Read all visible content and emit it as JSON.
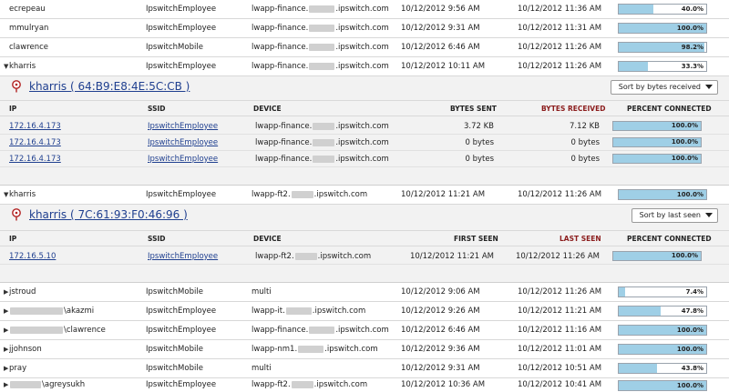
{
  "rows_top": [
    {
      "user": "ecrepeau",
      "ssid": "IpswitchEmployee",
      "dev_a": "lwapp-finance.",
      "dev_b": ".ipswitch.com",
      "first": "10/12/2012 9:56 AM",
      "last": "10/12/2012 11:36 AM",
      "pct": "40.0%",
      "pct_val": 40.0,
      "arrow": ""
    },
    {
      "user": "mmulryan",
      "ssid": "IpswitchEmployee",
      "dev_a": "lwapp-finance.",
      "dev_b": ".ipswitch.com",
      "first": "10/12/2012 9:31 AM",
      "last": "10/12/2012 11:31 AM",
      "pct": "100.0%",
      "pct_val": 100.0,
      "arrow": ""
    },
    {
      "user": "clawrence",
      "ssid": "IpswitchMobile",
      "dev_a": "lwapp-finance.",
      "dev_b": ".ipswitch.com",
      "first": "10/12/2012 6:46 AM",
      "last": "10/12/2012 11:26 AM",
      "pct": "98.2%",
      "pct_val": 98.2,
      "arrow": ""
    },
    {
      "user": "kharris",
      "ssid": "IpswitchEmployee",
      "dev_a": "lwapp-finance.",
      "dev_b": ".ipswitch.com",
      "first": "10/12/2012 10:11 AM",
      "last": "10/12/2012 11:26 AM",
      "pct": "33.3%",
      "pct_val": 33.3,
      "arrow": "▼"
    }
  ],
  "panel1": {
    "title": "kharris ( 64:B9:E8:4E:5C:CB )",
    "sort_label": "Sort by bytes received",
    "headers": {
      "ip": "IP",
      "ssid": "SSID",
      "device": "DEVICE",
      "col4": "BYTES SENT",
      "col5": "BYTES RECEIVED",
      "pct": "PERCENT CONNECTED"
    },
    "rows": [
      {
        "ip": "172.16.4.173",
        "ssid": "IpswitchEmployee",
        "dev_a": "lwapp-finance.",
        "dev_b": ".ipswitch.com",
        "c4": "3.72 KB",
        "c5": "7.12 KB",
        "pct": "100.0%",
        "pct_val": 100.0
      },
      {
        "ip": "172.16.4.173",
        "ssid": "IpswitchEmployee",
        "dev_a": "lwapp-finance.",
        "dev_b": ".ipswitch.com",
        "c4": "0 bytes",
        "c5": "0 bytes",
        "pct": "100.0%",
        "pct_val": 100.0
      },
      {
        "ip": "172.16.4.173",
        "ssid": "IpswitchEmployee",
        "dev_a": "lwapp-finance.",
        "dev_b": ".ipswitch.com",
        "c4": "0 bytes",
        "c5": "0 bytes",
        "pct": "100.0%",
        "pct_val": 100.0
      }
    ]
  },
  "row_mid": {
    "user": "kharris",
    "ssid": "IpswitchEmployee",
    "dev_a": "lwapp-ft2.",
    "dev_b": ".ipswitch.com",
    "first": "10/12/2012 11:21 AM",
    "last": "10/12/2012 11:26 AM",
    "pct": "100.0%",
    "pct_val": 100.0,
    "arrow": "▼"
  },
  "panel2": {
    "title": "kharris ( 7C:61:93:F0:46:96 )",
    "sort_label": "Sort by last seen",
    "headers": {
      "ip": "IP",
      "ssid": "SSID",
      "device": "DEVICE",
      "col4": "FIRST SEEN",
      "col5": "LAST SEEN",
      "pct": "PERCENT CONNECTED"
    },
    "rows": [
      {
        "ip": "172.16.5.10",
        "ssid": "IpswitchEmployee",
        "dev_a": "lwapp-ft2.",
        "dev_b": ".ipswitch.com",
        "c4": "10/12/2012 11:21 AM",
        "c5": "10/12/2012 11:26 AM",
        "pct": "100.0%",
        "pct_val": 100.0
      }
    ]
  },
  "rows_bottom": [
    {
      "user": "jstroud",
      "ssid": "IpswitchMobile",
      "dev_a": "multi",
      "dev_b": "",
      "first": "10/12/2012 9:06 AM",
      "last": "10/12/2012 11:26 AM",
      "pct": "7.4%",
      "pct_val": 7.4,
      "arrow": "▶",
      "blur_user": false
    },
    {
      "user": "\\akazmi",
      "ssid": "IpswitchEmployee",
      "dev_a": "lwapp-it.",
      "dev_b": ".ipswitch.com",
      "first": "10/12/2012 9:26 AM",
      "last": "10/12/2012 11:21 AM",
      "pct": "47.8%",
      "pct_val": 47.8,
      "arrow": "▶",
      "blur_user": true
    },
    {
      "user": "\\clawrence",
      "ssid": "IpswitchEmployee",
      "dev_a": "lwapp-finance.",
      "dev_b": ".ipswitch.com",
      "first": "10/12/2012 6:46 AM",
      "last": "10/12/2012 11:16 AM",
      "pct": "100.0%",
      "pct_val": 100.0,
      "arrow": "▶",
      "blur_user": true
    },
    {
      "user": "jjohnson",
      "ssid": "IpswitchMobile",
      "dev_a": "lwapp-nm1.",
      "dev_b": ".ipswitch.com",
      "first": "10/12/2012 9:36 AM",
      "last": "10/12/2012 11:01 AM",
      "pct": "100.0%",
      "pct_val": 100.0,
      "arrow": "▶",
      "blur_user": false
    },
    {
      "user": "pray",
      "ssid": "IpswitchMobile",
      "dev_a": "multi",
      "dev_b": "",
      "first": "10/12/2012 9:31 AM",
      "last": "10/12/2012 10:51 AM",
      "pct": "43.8%",
      "pct_val": 43.8,
      "arrow": "▶",
      "blur_user": false
    },
    {
      "user": "\\agreysukh",
      "ssid": "IpswitchEmployee",
      "dev_a": "lwapp-ft2.",
      "dev_b": ".ipswitch.com",
      "first": "10/12/2012 10:36 AM",
      "last": "10/12/2012 10:41 AM",
      "pct": "100.0%",
      "pct_val": 100.0,
      "arrow": "▶",
      "blur_user": true
    }
  ]
}
